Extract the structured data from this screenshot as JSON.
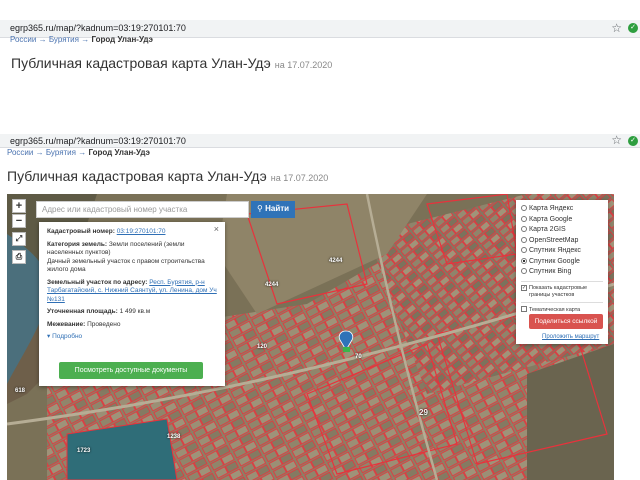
{
  "chrome": {
    "url": "egrp365.ru/map/?kadnum=03:19:270101:70",
    "star": "☆"
  },
  "breadcrumbs": {
    "items": [
      "России",
      "Бурятия",
      "Город Улан-Удэ"
    ],
    "separator": "→"
  },
  "page": {
    "title": "Публичная кадастровая карта Улан-Удэ",
    "date": "на 17.07.2020"
  },
  "map": {
    "zoom_in": "+",
    "zoom_out": "−",
    "search_placeholder": "Адрес или кадастровый номер участка",
    "find_label": "Найти",
    "find_icon": "search-icon",
    "info": {
      "close": "×",
      "cadnum_label": "Кадастровый номер:",
      "cadnum_value": "03:19:270101:70",
      "category_label": "Категория земель:",
      "category_value": "Земли поселений (земли населенных пунктов)",
      "usage": "Дачный земельный участок с правом строительства жилого дома",
      "address_label": "Земельный участок по адресу:",
      "address_value": "Респ. Бурятия, р-н Тарбагатайский, с. Нижний Саянтуй, ул. Ленина, дом Уч №131",
      "area_label": "Уточненная площадь:",
      "area_value": "1 499 кв.м",
      "bounds_label": "Межевание:",
      "bounds_value": "Проведено",
      "more": "Подробно",
      "docs_button": "Посмотреть доступные документы"
    },
    "layers": {
      "options": [
        {
          "label": "Карта Яндекс",
          "selected": false
        },
        {
          "label": "Карта Google",
          "selected": false
        },
        {
          "label": "Карта 2GIS",
          "selected": false
        },
        {
          "label": "OpenStreetMap",
          "selected": false
        },
        {
          "label": "Спутник Яндекс",
          "selected": false
        },
        {
          "label": "Спутник Google",
          "selected": true
        },
        {
          "label": "Спутник Bing",
          "selected": false
        }
      ],
      "show_borders": "Показать кадастровые границы участков",
      "thematic": "Тематическая карта",
      "share_button": "Поделиться ссылкой",
      "route_link": "Проложить маршрут"
    },
    "plot_numbers": [
      "4244",
      "4244",
      "120",
      "618",
      "1238",
      "1723",
      "29",
      "70"
    ],
    "colors": {
      "boundary": "#e8323c",
      "find_button": "#2f73b8",
      "docs_button": "#4caf50",
      "share_button": "#d9534f"
    }
  }
}
